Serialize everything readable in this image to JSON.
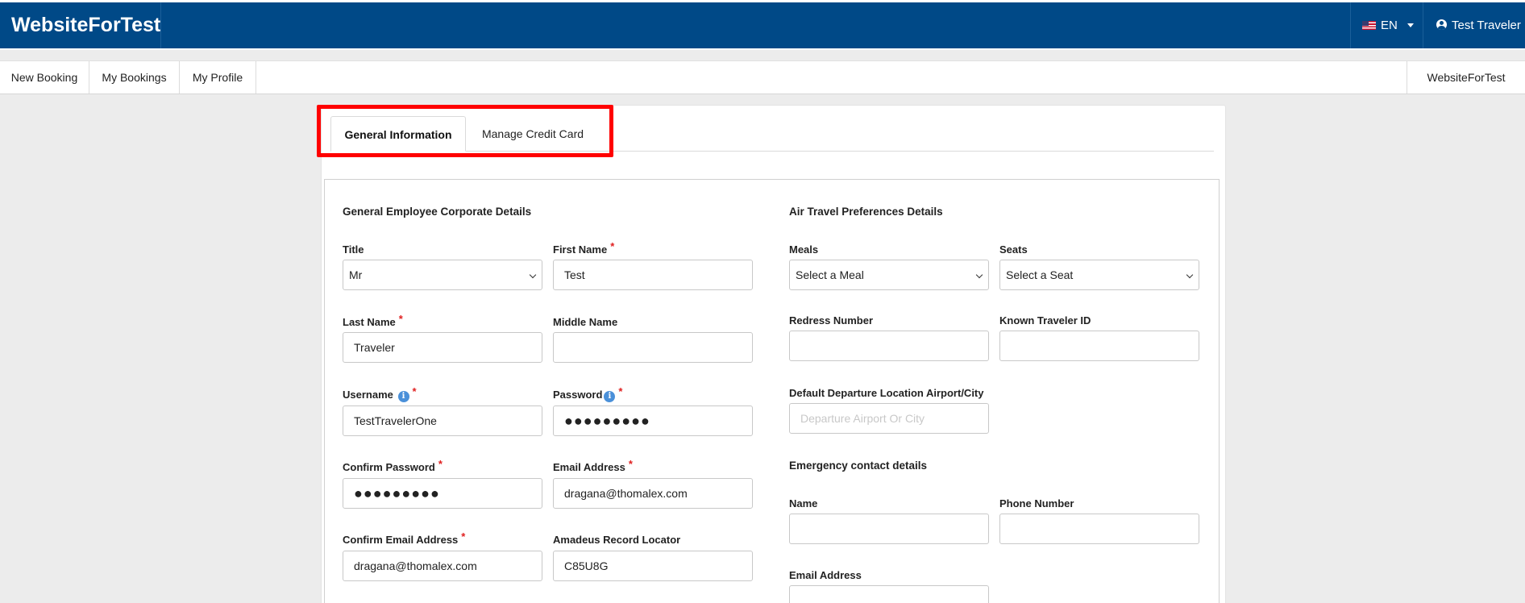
{
  "app": {
    "brand": "WebsiteForTest",
    "language": "EN",
    "user_name": "Test Traveler"
  },
  "subnav": {
    "items": [
      "New Booking",
      "My Bookings",
      "My Profile"
    ],
    "right_label": "WebsiteForTest"
  },
  "tabs": {
    "active": "General Information",
    "inactive": "Manage Credit Card"
  },
  "left_section": {
    "title": "General Employee Corporate Details",
    "title_label": "Title",
    "title_value": "Mr",
    "first_name_label": "First Name",
    "first_name_value": "Test",
    "last_name_label": "Last Name",
    "last_name_value": "Traveler",
    "middle_name_label": "Middle Name",
    "middle_name_value": "",
    "username_label": "Username",
    "username_value": "TestTravelerOne",
    "password_label": "Password",
    "password_value": "●●●●●●●●●",
    "confirm_password_label": "Confirm Password",
    "confirm_password_value": "●●●●●●●●●",
    "email_label": "Email Address",
    "email_value": "dragana@thomalex.com",
    "confirm_email_label": "Confirm Email Address",
    "confirm_email_value": "dragana@thomalex.com",
    "record_locator_label": "Amadeus Record Locator",
    "record_locator_value": "C85U8G",
    "required_mark": "*",
    "info_mark": "i"
  },
  "right_section": {
    "title": "Air Travel Preferences Details",
    "meals_label": "Meals",
    "meals_value": "Select a Meal",
    "seats_label": "Seats",
    "seats_value": "Select a Seat",
    "redress_label": "Redress Number",
    "known_traveler_label": "Known Traveler ID",
    "departure_label": "Default Departure Location Airport/City",
    "departure_placeholder": "Departure Airport Or City",
    "emergency_title": "Emergency contact details",
    "name_label": "Name",
    "phone_label": "Phone Number",
    "email_label": "Email Address"
  }
}
